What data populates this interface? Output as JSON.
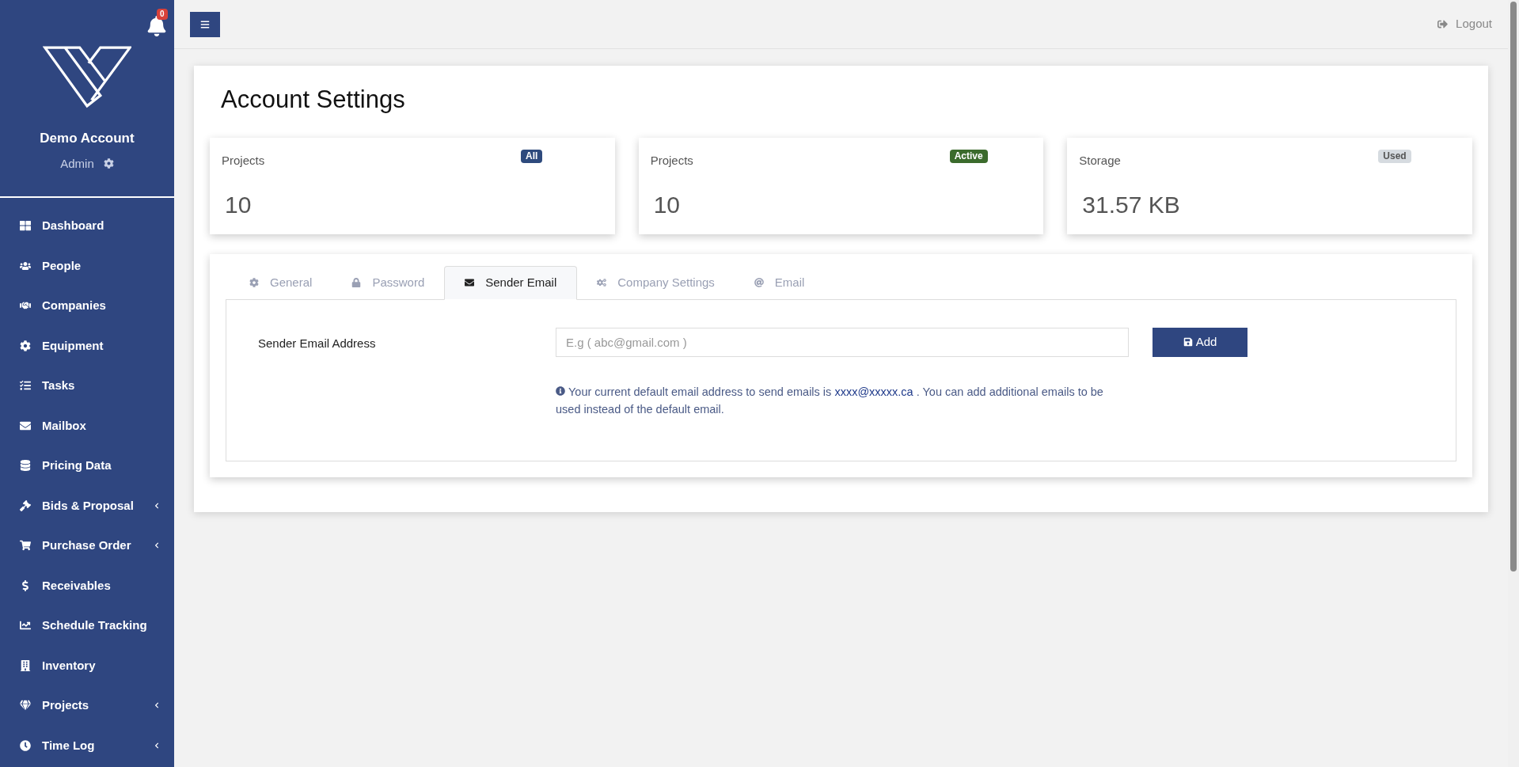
{
  "sidebar": {
    "notification_count": "0",
    "account_name": "Demo Account",
    "role": "Admin",
    "items": [
      {
        "label": "Dashboard",
        "has_submenu": false
      },
      {
        "label": "People",
        "has_submenu": false
      },
      {
        "label": "Companies",
        "has_submenu": false
      },
      {
        "label": "Equipment",
        "has_submenu": false
      },
      {
        "label": "Tasks",
        "has_submenu": false
      },
      {
        "label": "Mailbox",
        "has_submenu": false
      },
      {
        "label": "Pricing Data",
        "has_submenu": false
      },
      {
        "label": "Bids & Proposal",
        "has_submenu": true
      },
      {
        "label": "Purchase Order",
        "has_submenu": true
      },
      {
        "label": "Receivables",
        "has_submenu": false
      },
      {
        "label": "Schedule Tracking",
        "has_submenu": false
      },
      {
        "label": "Inventory",
        "has_submenu": false
      },
      {
        "label": "Projects",
        "has_submenu": true
      },
      {
        "label": "Time Log",
        "has_submenu": true
      }
    ]
  },
  "topbar": {
    "logout": "Logout"
  },
  "page": {
    "title": "Account Settings",
    "stats": [
      {
        "label": "Projects",
        "badge": "All",
        "color": "#2e4a7d",
        "value": "10"
      },
      {
        "label": "Projects",
        "badge": "Active",
        "color": "#3b6b2c",
        "value": "10"
      },
      {
        "label": "Storage",
        "badge": "Used",
        "color": "#d6dbe0",
        "value": "31.57 KB"
      }
    ],
    "tabs": [
      {
        "label": "General",
        "selected": false
      },
      {
        "label": "Password",
        "selected": false
      },
      {
        "label": "Sender Email",
        "selected": true
      },
      {
        "label": "Company Settings",
        "selected": false
      },
      {
        "label": "Email",
        "selected": false
      }
    ],
    "form": {
      "label": "Sender Email Address",
      "placeholder": "E.g ( abc@gmail.com )",
      "button": "Add",
      "info_before": "Your current default email address to send emails is",
      "info_link": "xxxx@xxxxx.ca",
      "info_after": ". You can add additional emails to be used instead of the default email."
    }
  }
}
